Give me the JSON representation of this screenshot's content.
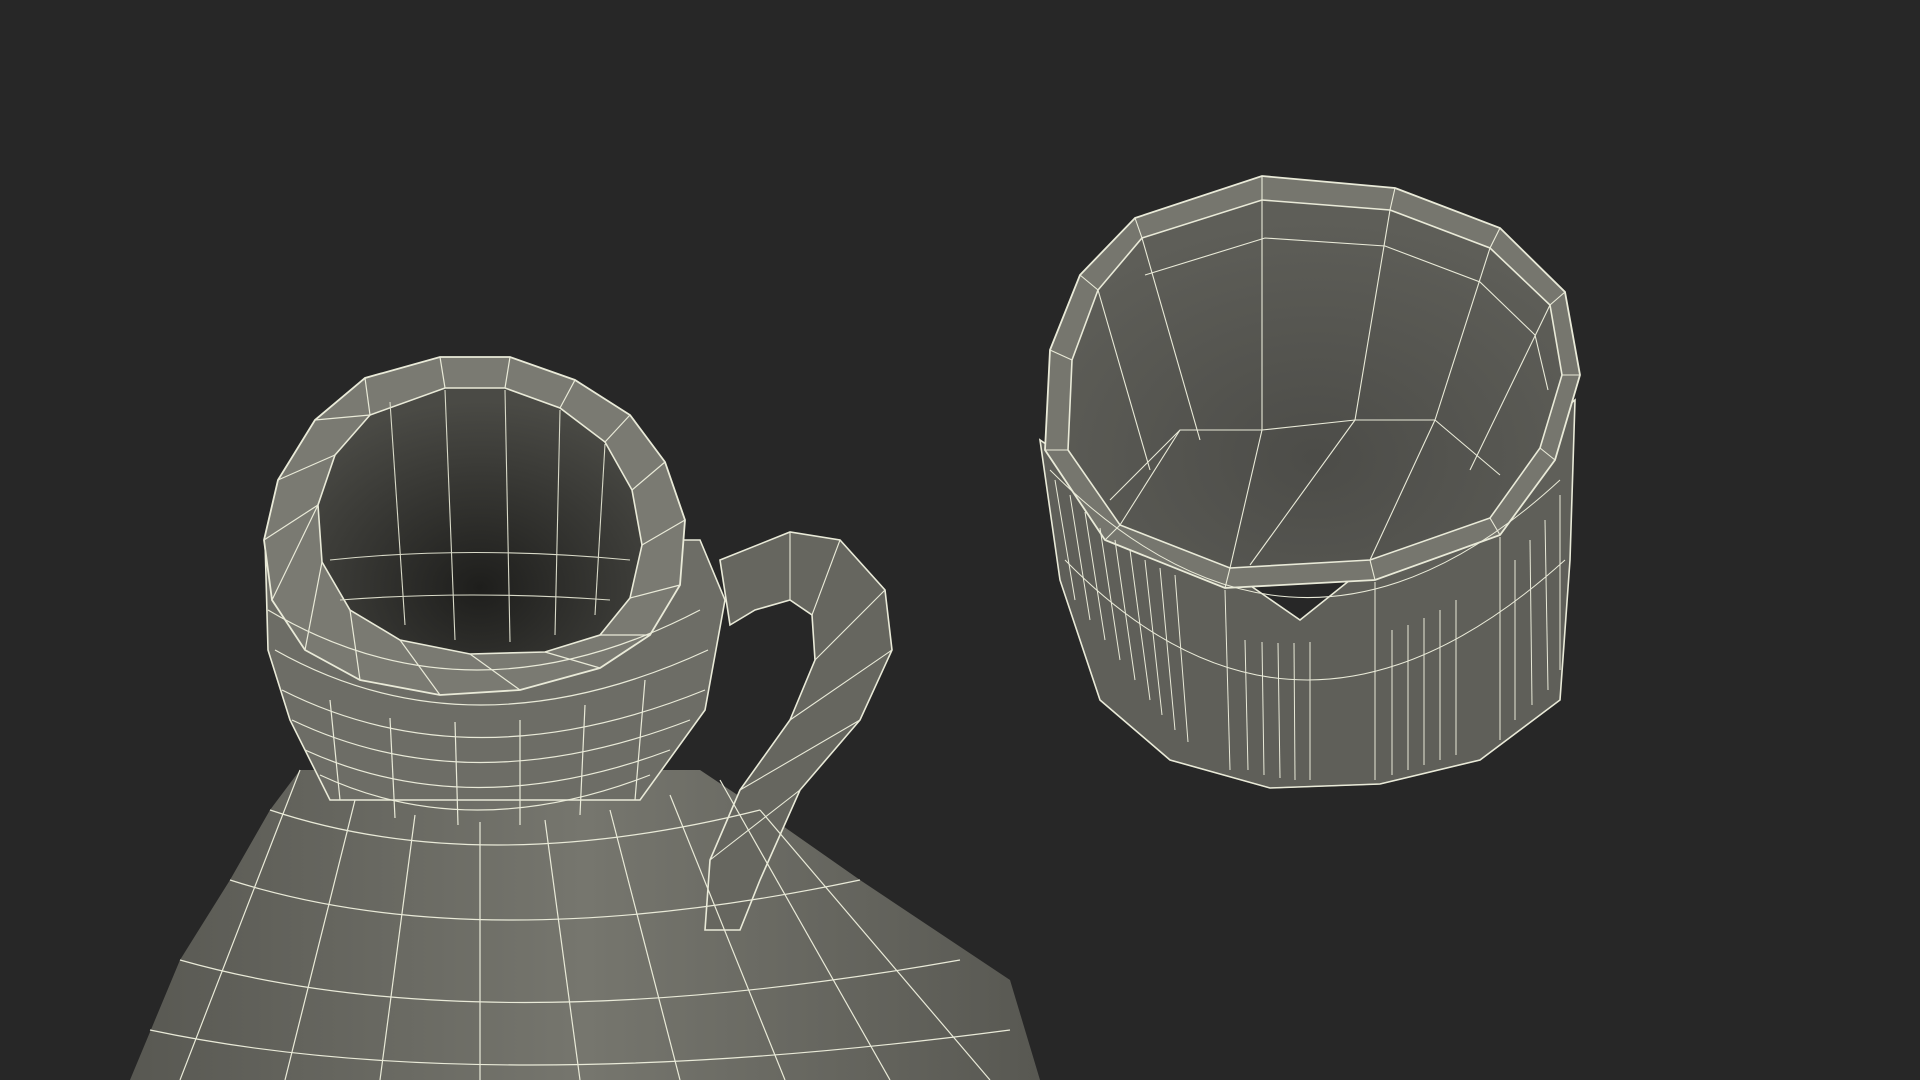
{
  "scene": {
    "background_color": "#272727",
    "mesh_fill_color": "#6b6b64",
    "mesh_shade_color": "#55554f",
    "mesh_dark_color": "#3a3a36",
    "wire_color": "#e9ead8",
    "objects": [
      {
        "name": "jug-bottle",
        "description_icon": "jug-icon"
      },
      {
        "name": "cap-lid",
        "description_icon": "cap-icon"
      }
    ]
  }
}
